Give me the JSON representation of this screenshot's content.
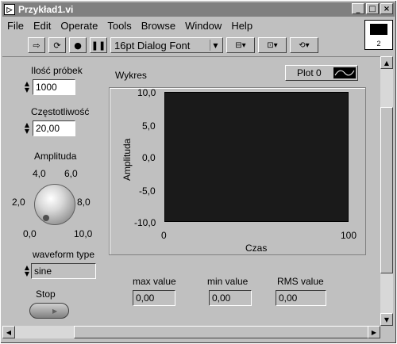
{
  "window": {
    "title": "Przykład1.vi",
    "minimize": "_",
    "maximize": "□",
    "close": "×"
  },
  "menu": [
    "File",
    "Edit",
    "Operate",
    "Tools",
    "Browse",
    "Window",
    "Help"
  ],
  "toolbar": {
    "run_icon": "run-arrow-icon",
    "run_continuous_icon": "run-continuously-icon",
    "abort_icon": "abort-icon",
    "pause_icon": "pause-icon",
    "font": "16pt Dialog Font",
    "align_icon": "align-objects-icon",
    "distribute_icon": "distribute-objects-icon",
    "reorder_icon": "reorder-icon"
  },
  "vi_icon": {
    "label": "2"
  },
  "controls": {
    "samples": {
      "label": "Ilość próbek",
      "value": "1000"
    },
    "frequency": {
      "label": "Częstotliwość",
      "value": "20,00"
    },
    "amplitude": {
      "label": "Amplituda",
      "value": 0,
      "scale": [
        "0,0",
        "2,0",
        "4,0",
        "6,0",
        "8,0",
        "10,0"
      ]
    },
    "waveform": {
      "label": "waveform type",
      "value": "sine"
    },
    "stop": {
      "label": "Stop"
    }
  },
  "indicators": {
    "max": {
      "label": "max value",
      "value": "0,00"
    },
    "min": {
      "label": "min value",
      "value": "0,00"
    },
    "rms": {
      "label": "RMS value",
      "value": "0,00"
    }
  },
  "graph": {
    "title": "Wykres",
    "legend": "Plot 0",
    "xlabel": "Czas",
    "ylabel": "Amplituda",
    "y_ticks": [
      "10,0",
      "5,0",
      "0,0",
      "-5,0",
      "-10,0"
    ],
    "x_ticks": [
      "0",
      "100"
    ],
    "bg_color": "#1a1a1a"
  }
}
